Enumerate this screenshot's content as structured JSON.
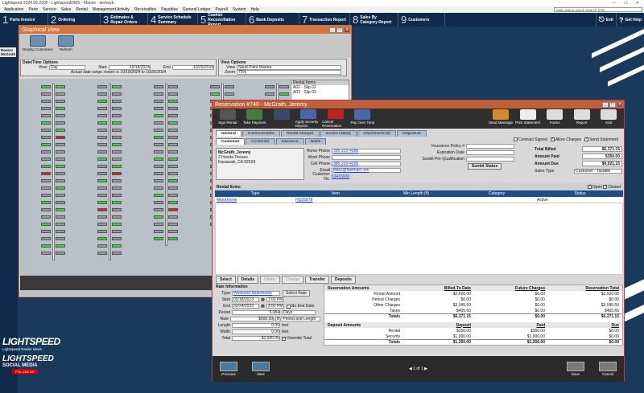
{
  "app": {
    "title": "Lightspeed 2024.09.2305 - LightspeedDMS - Marine - tierneyb",
    "menus": [
      "Application",
      "Parts",
      "Service",
      "Sales",
      "Rental",
      "Management Activity",
      "Receivables",
      "Payables",
      "General Ledger",
      "Payroll",
      "System",
      "Help"
    ],
    "search_placeholder": "Main Menu Quick Search (F8)"
  },
  "toolbar": [
    {
      "num": "1",
      "label": "Parts Invoice"
    },
    {
      "num": "2",
      "label": "Ordering"
    },
    {
      "num": "3",
      "label": "Estimates & Repair Orders"
    },
    {
      "num": "4",
      "label": "Service Schedule Summary"
    },
    {
      "num": "5",
      "label": "Cashier Reconciliation Report"
    },
    {
      "num": "6",
      "label": "Bank Deposits"
    },
    {
      "num": "7",
      "label": "Transaction Report"
    },
    {
      "num": "8",
      "label": "Sales By Category Report"
    },
    {
      "num": "9",
      "label": "Customers"
    }
  ],
  "toolbar_right": [
    {
      "label": "Exit"
    },
    {
      "label": "Get Help"
    }
  ],
  "sidebar_tabs": [
    "Reserv McGrath"
  ],
  "branding": {
    "brand": "LIGHTSPEED",
    "news": "Lightspeed Dealer News",
    "social": "LIGHTSPEED",
    "social2": "SOCIAL MEDIA",
    "follow": "FOLLOW US"
  },
  "graphical": {
    "title": "Graphical View",
    "buttons": [
      "Display Customers",
      "Refresh"
    ],
    "dt_header": "Date/Time Options",
    "view_label": "View",
    "view_value": "Day",
    "start_label": "Start",
    "start_value": "10/18/2024",
    "end_label": "End",
    "end_value": "10/25/2024",
    "range_note": "Actual date range shown is 10/18/2024 to 10/25/2024",
    "vo_header": "View Options",
    "vo_view_label": "View",
    "vo_view_value": "Spud Point Marina",
    "zoom_label": "Zoom",
    "zoom_value": "75%",
    "rental_items_header": "Rental Items",
    "rental_items": [
      "A02 - Slip 02",
      "A03 - Slip 03"
    ]
  },
  "reservation": {
    "title": "Reservation #740 - McGrath, Jeremy",
    "toolbar": [
      "Sign Rental",
      "Take Payment",
      "",
      "Apply Security Deposit",
      "Cancel Reservation",
      "Pay Over Time",
      "Send Message",
      "Print Statement",
      "Forms",
      "Report",
      "Edit"
    ],
    "tabs": [
      "General",
      "Communication",
      "Rental Charges",
      "Invoice History",
      "Attachments (5)",
      "eSignature"
    ],
    "subtabs": [
      "Customer",
      "Co-Renter",
      "Insurance",
      "Notes"
    ],
    "customer": {
      "name": "McGrath, Jeremy",
      "addr1": "2 Honda Terrace",
      "addr2": "Kawasaki, CA 92024"
    },
    "phones": [
      {
        "label": "Home Phone",
        "value": "385-220-4395"
      },
      {
        "label": "Work Phone",
        "value": ""
      },
      {
        "label": "Cell Phone",
        "value": "385-220-4395"
      },
      {
        "label": "Email",
        "value": "jlfasc@fastmail.com"
      },
      {
        "label": "Customer No.",
        "value": "53416936"
      }
    ],
    "insurance": {
      "policy_label": "Insurance Policy #",
      "exp_label": "Expiration Date",
      "prequal_label": "Sunbit Pre-Qualification",
      "sunbit_btn": "Sunbit Status"
    },
    "checks": {
      "contract_signed": "Contract Signed",
      "allow_charges": "Allow Charges",
      "send_statement": "Send Statement"
    },
    "totals": [
      {
        "label": "Total Billed",
        "value": "$6,371.15"
      },
      {
        "label": "Amount Paid",
        "value": "$350.00"
      },
      {
        "label": "Amount Due",
        "value": "$6,021.15"
      }
    ],
    "sales_type_label": "Sales Type",
    "sales_type_value": "Customer - Taxable",
    "rental_items_label": "Rental Items",
    "open_label": "Open",
    "closed_label": "Closed",
    "grid_headers": [
      "Type",
      "Item",
      "Min Length (ft)",
      "Category",
      "Status"
    ],
    "grid_row": [
      "Motorhome",
      "HQ25878",
      "",
      "",
      "Active"
    ],
    "sub_buttons": [
      "Select",
      "Details",
      "Delete",
      "Change",
      "Transfer",
      "Deposits"
    ],
    "rate": {
      "header": "Rate Information",
      "type_label": "Type",
      "type_value": "Weekend-Motorhome",
      "select_rate": "Select Rate",
      "start_label": "Start",
      "start_date": "02/18/2023",
      "start_time": "1:00 PM",
      "end_label": "End",
      "end_date": "02/24/2023",
      "end_time": "3:00 PM",
      "no_end": "No End Date",
      "period_label": "Period",
      "period_value": "5.084",
      "period_unit": "Days",
      "rate_label": "Rate",
      "rate_value": "$500.00",
      "rate_mode": "By Period and Length",
      "length_label": "Length",
      "length_value": "0.00",
      "width_label": "Width",
      "width_value": "0.00",
      "feet": "feet",
      "total_label": "Total",
      "total_value": "$2,920.00",
      "override": "Override Total"
    },
    "amounts": {
      "headers": [
        "Reservation Amounts",
        "Billed-To Date",
        "Future Charges",
        "Reservation Total"
      ],
      "rows": [
        [
          "Rental Amount",
          "$2,920.00",
          "$0.00",
          "$2,920.00"
        ],
        [
          "Period Charges",
          "$0.00",
          "$0.00",
          "$0.00"
        ],
        [
          "Other Charges",
          "$3,045.50",
          "$0.00",
          "$3,045.50"
        ],
        [
          "Taxes",
          "$405.65",
          "$0.00",
          "$405.65"
        ]
      ],
      "totals_row": [
        "Totals",
        "$6,371.15",
        "$0.00",
        "$6,371.15"
      ],
      "dep_headers": [
        "Deposit Amounts",
        "Deposit",
        "Paid",
        "Due"
      ],
      "dep_rows": [
        [
          "Rental",
          "$250.00",
          "$350.00",
          "$0.00"
        ],
        [
          "Security",
          "$1,000.00",
          "$1,000.00",
          "$0.00"
        ]
      ],
      "dep_totals": [
        "Totals",
        "$1,250.00",
        "$1,250.00",
        "$0.00"
      ]
    },
    "footer": {
      "previous": "Previous",
      "next": "Next",
      "pager": "1 of 1",
      "save": "Save",
      "cancel": "Cancel"
    }
  }
}
